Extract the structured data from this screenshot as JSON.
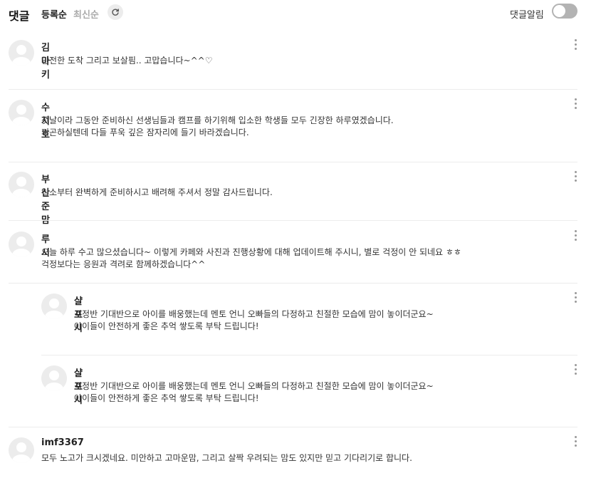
{
  "header": {
    "title": "댓글",
    "sort_options": [
      "등록순",
      "최신순"
    ],
    "notification_label": "댓글알림",
    "notification_on": false
  },
  "comments": [
    {
      "author": "김마키",
      "lines": [
        "안전한 도착 그리고 보살핌.. 고맙습니다~^^♡"
      ]
    },
    {
      "author": "수지호",
      "lines": [
        "첫날이라 그동안 준비하신 선생님들과 캠프를 하기위해 입소한 학생들 모두 긴장한 하루였겠습니다.",
        "피곤하실텐데 다들 푸욱 깊은 잠자리에 들기 바라겠습니다."
      ]
    },
    {
      "author": "부산준맘",
      "lines": [
        "입소부터 완벽하게 준비하시고 배려해 주셔서 정말 감사드립니다."
      ]
    },
    {
      "author": "루시",
      "lines": [
        "오늘 하루 수고 많으셨습니다~ 이렇게 카페와 사진과 진행상황에 대해 업데이트해 주시니, 별로 걱정이 안 되네요 ㅎㅎ",
        "걱정보다는 응원과 격려로 함께하겠습니다^^"
      ]
    },
    {
      "author": "샬포시",
      "reply": true,
      "lines": [
        "걱정반 기대반으로 아이를 배웅했는데 멘토 언니 오빠들의 다정하고 친절한 모습에 맘이 놓이더군요~",
        "아이들이 안전하게 좋은 추억 쌓도록 부탁 드립니다!"
      ]
    },
    {
      "author": "샬포시",
      "reply": true,
      "lines": [
        "걱정반 기대반으로 아이를 배웅했는데 멘토 언니 오빠들의 다정하고 친절한 모습에 맘이 놓이더군요~",
        "아이들이 안전하게 좋은 추억 쌓도록 부탁 드립니다!"
      ]
    },
    {
      "author": "imf3367",
      "lines": [
        "모두 노고가 크시겠네요. 미안하고 고마운맘, 그리고 살짝 우려되는 맘도 있지만 믿고 기다리기로 합니다."
      ]
    }
  ]
}
